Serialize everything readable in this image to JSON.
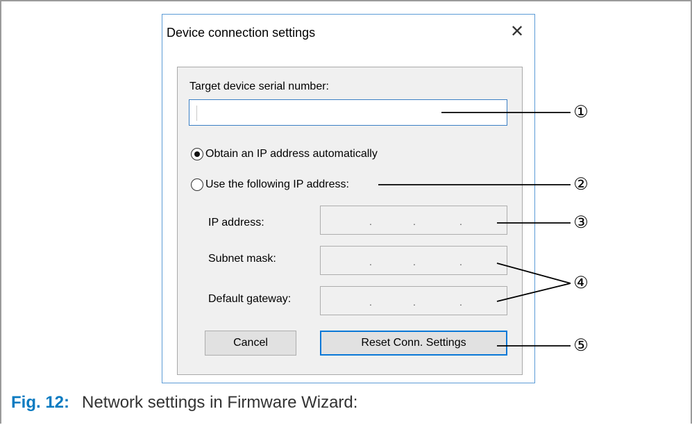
{
  "dialog": {
    "title": "Device connection settings",
    "close_symbol": "✕",
    "serial_label": "Target device serial number:",
    "serial_value": "",
    "radio_auto_label": "Obtain an IP address automatically",
    "radio_auto_selected": true,
    "radio_manual_label": "Use the following IP address:",
    "radio_manual_selected": false,
    "fields": [
      {
        "label": "IP address:",
        "separator": ".  .  ."
      },
      {
        "label": "Subnet mask:",
        "separator": ".  .  ."
      },
      {
        "label": "Default gateway:",
        "separator": ".  .  ."
      }
    ],
    "cancel_label": "Cancel",
    "reset_label": "Reset Conn. Settings"
  },
  "callouts": [
    "①",
    "②",
    "③",
    "④",
    "⑤"
  ],
  "caption": {
    "fig": "Fig. 12:",
    "text": "Network settings in Firmware Wizard:"
  },
  "colors": {
    "accent": "#0a78d7",
    "caption_fig": "#0a7bc1"
  },
  "icons": {
    "close": "close-icon",
    "radio": "radio-icon"
  }
}
